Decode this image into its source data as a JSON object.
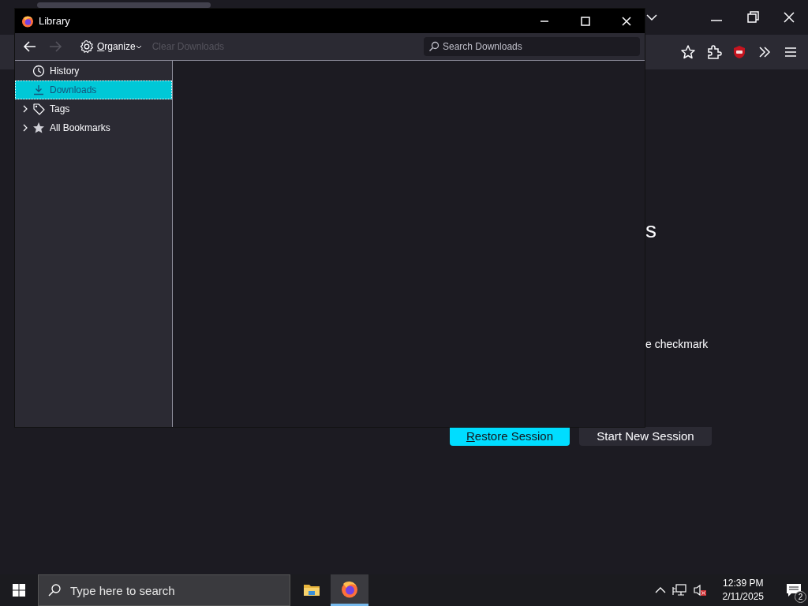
{
  "browser": {
    "content": {
      "heading_fragment": "s",
      "text_fragment": "e checkmark",
      "buttons": [
        {
          "label": "Restore Session",
          "kind": "primary"
        },
        {
          "label": "Start New Session",
          "kind": "secondary"
        }
      ]
    }
  },
  "library": {
    "window": {
      "title": "Library"
    },
    "toolbar": {
      "back": {
        "disabled": false
      },
      "forward": {
        "disabled": true
      },
      "organize": "Organize",
      "clear": {
        "label": "Clear Downloads",
        "disabled": true
      },
      "search": {
        "placeholder": "Search Downloads"
      }
    },
    "sidebar": {
      "items": [
        {
          "label": "History",
          "selected": false
        },
        {
          "label": "Downloads",
          "selected": true
        },
        {
          "label": "Tags",
          "selected": false,
          "expanded": false
        },
        {
          "label": "All Bookmarks",
          "selected": false,
          "expanded": false
        }
      ]
    }
  },
  "taskbar": {
    "search": {
      "placeholder": "Type here to search"
    },
    "apps": [
      {
        "selected": false
      },
      {
        "selected": true
      }
    ],
    "time": "12:39 PM",
    "date": "2/11/2025",
    "notifications": "2"
  }
}
